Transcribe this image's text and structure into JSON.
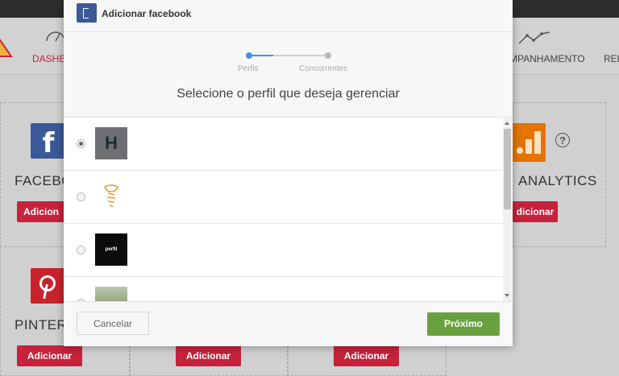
{
  "background": {
    "nav": {
      "dashboard_label": "DASHB",
      "acompanhamento_label": "MPANHAMENTO",
      "relatorios_label": "REL"
    },
    "cards": [
      {
        "name": "FACEBO",
        "button": "Adicion"
      },
      {
        "name": "ANALYTICS",
        "button": "dicionar"
      },
      {
        "name": "PINTERE",
        "button": "Adicionar"
      }
    ],
    "bottom_buttons": [
      "Adicionar",
      "Adicionar"
    ],
    "help_label": "?",
    "colors": {
      "accent_red": "#c6223b",
      "facebook_blue": "#3b5998",
      "analytics_orange": "#e37400"
    }
  },
  "modal": {
    "title": "Adicionar facebook",
    "steps": [
      {
        "label": "Perfis",
        "active": true
      },
      {
        "label": "Concorrentes",
        "active": false
      }
    ],
    "heading": "Selecione o perfil que deseja gerenciar",
    "profiles": [
      {
        "avatar": "letter-h-avatar",
        "initial": "H",
        "selected": true
      },
      {
        "avatar": "tooth-logo-avatar",
        "selected": false
      },
      {
        "avatar": "dark-logo-avatar",
        "logo_text": "perfil",
        "selected": false
      },
      {
        "avatar": "photo-avatar",
        "selected": false
      }
    ],
    "buttons": {
      "cancel": "Cancelar",
      "next": "Próximo"
    },
    "colors": {
      "step_active": "#4a90e2",
      "next_button": "#6aa13f"
    }
  }
}
